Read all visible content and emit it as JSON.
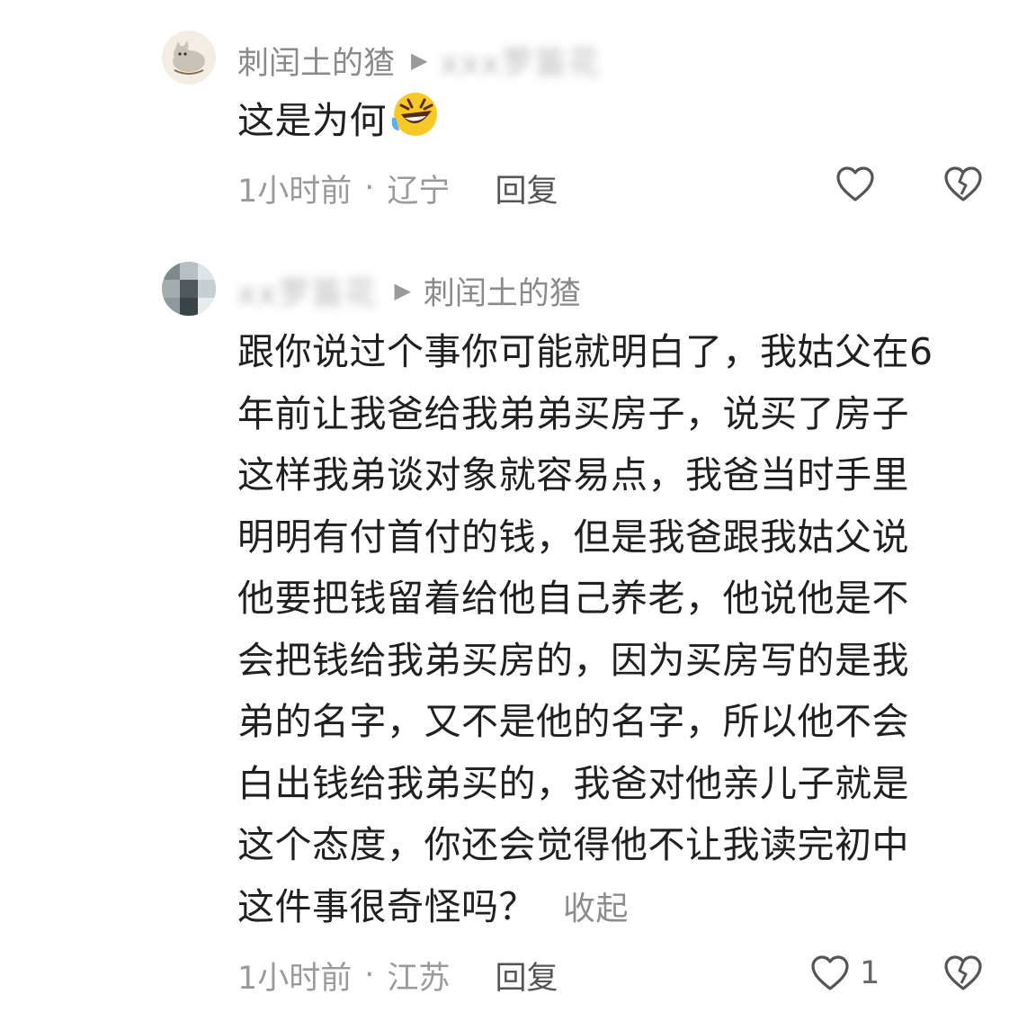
{
  "comments": [
    {
      "author": "刺闰土的猹",
      "reply_to": "xxx罗笛花",
      "text": "这是为何",
      "emoji": "rolling-laughing-emoji",
      "time": "1小时前",
      "location": "辽宁",
      "reply_label": "回复",
      "like_count": ""
    },
    {
      "author": "xx罗笛花",
      "reply_to": "刺闰土的猹",
      "lines": [
        "跟你说过个事你可能就明白了，我姑父在6",
        "年前让我爸给我弟弟买房子，说买了房子",
        "这样我弟谈对象就容易点，我爸当时手里",
        "明明有付首付的钱，但是我爸跟我姑父说",
        "他要把钱留着给他自己养老，他说他是不",
        "会把钱给我弟买房的，因为买房写的是我",
        "弟的名字，又不是他的名字，所以他不会",
        "白出钱给我弟买的，我爸对他亲儿子就是",
        "这个态度，你还会觉得他不让我读完初中",
        "这件事很奇怪吗？"
      ],
      "collapse_label": "收起",
      "time": "1小时前",
      "location": "江苏",
      "reply_label": "回复",
      "like_count": "1"
    }
  ],
  "separator": "·"
}
